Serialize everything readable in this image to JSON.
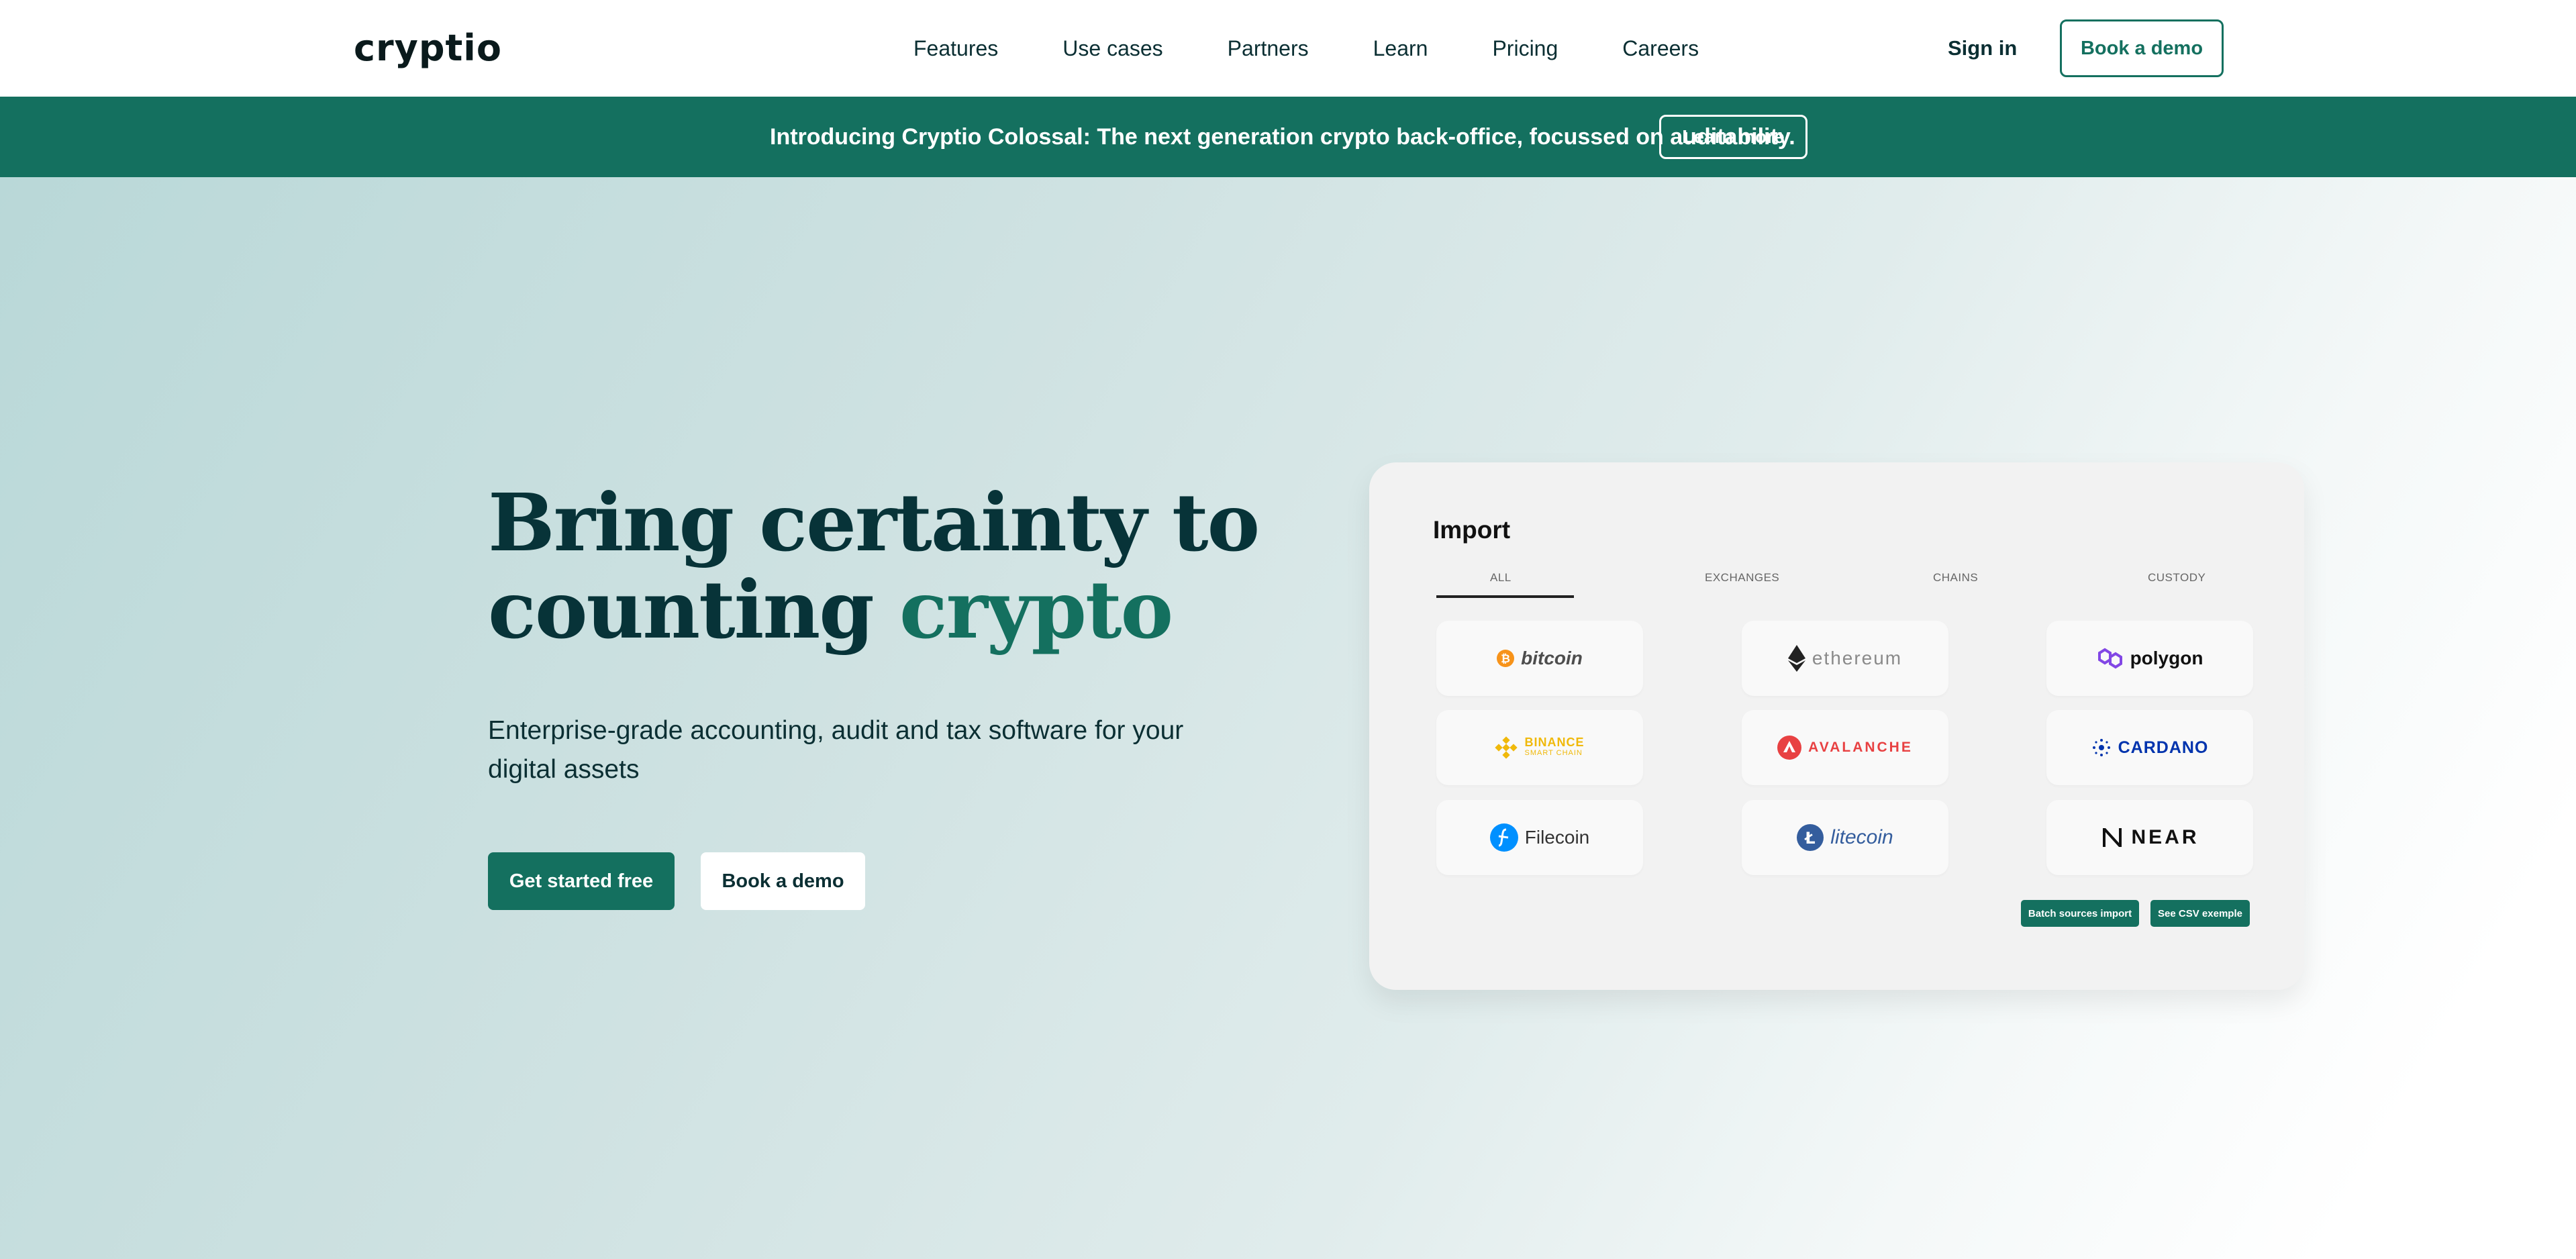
{
  "header": {
    "logo": "cryptio",
    "nav": [
      "Features",
      "Use cases",
      "Partners",
      "Learn",
      "Pricing",
      "Careers"
    ],
    "sign_in": "Sign in",
    "book_demo": "Book a demo"
  },
  "banner": {
    "text": "Introducing Cryptio Colossal: The next generation crypto back-office, focussed on auditability.",
    "button": "Learn more"
  },
  "hero": {
    "headline_line1": "Bring certainty to",
    "headline_line2_plain": "counting ",
    "headline_line2_accent": "crypto",
    "subhead": "Enterprise-grade accounting, audit and tax software for your digital assets",
    "cta_primary": "Get started free",
    "cta_secondary": "Book a demo"
  },
  "import_card": {
    "title": "Import",
    "tabs": [
      "ALL",
      "EXCHANGES",
      "CHAINS",
      "CUSTODY"
    ],
    "active_tab": "ALL",
    "sources": [
      {
        "label": "bitcoin",
        "icon": "bitcoin-icon",
        "color": "#f7931a"
      },
      {
        "label": "ethereum",
        "icon": "ethereum-icon",
        "color": "#8a8a8a"
      },
      {
        "label": "polygon",
        "icon": "polygon-icon",
        "color": "#8247e5"
      },
      {
        "label": "BINANCE",
        "sublabel": "SMART CHAIN",
        "icon": "binance-icon",
        "color": "#f0b90b"
      },
      {
        "label": "AVALANCHE",
        "icon": "avalanche-icon",
        "color": "#e84142"
      },
      {
        "label": "CARDANO",
        "icon": "cardano-icon",
        "color": "#0033ad"
      },
      {
        "label": "Filecoin",
        "icon": "filecoin-icon",
        "color": "#0090ff"
      },
      {
        "label": "litecoin",
        "icon": "litecoin-icon",
        "color": "#345d9d"
      },
      {
        "label": "NEAR",
        "icon": "near-icon",
        "color": "#111111"
      }
    ],
    "batch_button": "Batch sources import",
    "csv_button": "See CSV exemple"
  },
  "colors": {
    "brand_green": "#14705f",
    "headline_dark": "#073338"
  }
}
